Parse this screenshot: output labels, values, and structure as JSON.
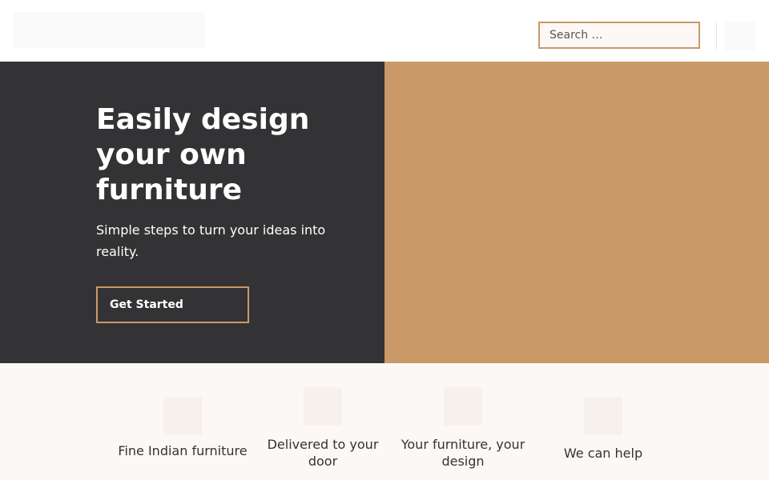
{
  "header": {
    "search_placeholder": "Search …"
  },
  "hero": {
    "title": "Easily design your own furniture",
    "subtitle": "Simple steps to turn your ideas into reality.",
    "cta_label": "Get Started"
  },
  "features": [
    {
      "label": "Fine Indian furniture"
    },
    {
      "label": "Delivered to your door"
    },
    {
      "label": "Your furniture, your design"
    },
    {
      "label": "We can help"
    }
  ],
  "colors": {
    "accent": "#c99a68",
    "hero_dark": "#333335",
    "features_bg": "#fcf8f5"
  }
}
